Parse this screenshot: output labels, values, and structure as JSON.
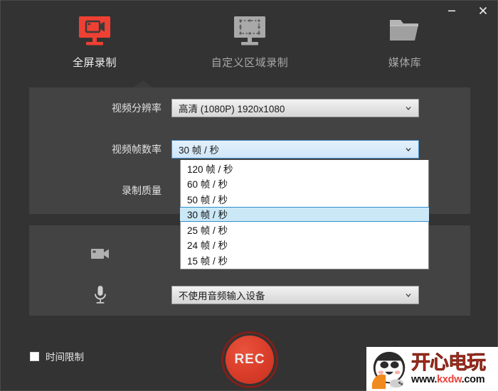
{
  "window": {
    "minimize_label": "—",
    "close_label": "✕",
    "bg_color": "#333333",
    "panel_color": "#434343",
    "accent_color": "#e8403a"
  },
  "tabs": [
    {
      "label": "全屏录制",
      "icon": "monitor-record-icon",
      "active": true
    },
    {
      "label": "自定义区域录制",
      "icon": "monitor-region-icon",
      "active": false
    },
    {
      "label": "媒体库",
      "icon": "folder-icon",
      "active": false
    }
  ],
  "video_panel": {
    "rows": [
      {
        "label": "视频分辨率",
        "value": "高清 (1080P)   1920x1080"
      },
      {
        "label": "视频帧数率",
        "value": "30 帧 / 秒"
      },
      {
        "label": "录制质量",
        "value": ""
      }
    ]
  },
  "fps_dropdown": {
    "open": true,
    "selected": "30 帧 / 秒",
    "options": [
      "120 帧 / 秒",
      "60 帧 / 秒",
      "50 帧 / 秒",
      "30 帧 / 秒",
      "25 帧 / 秒",
      "24 帧 / 秒",
      "15 帧 / 秒"
    ]
  },
  "device_panel": {
    "rows": [
      {
        "icon": "camera-icon",
        "value": ""
      },
      {
        "icon": "microphone-icon",
        "value": "不使用音频输入设备"
      }
    ]
  },
  "bottom": {
    "time_limit_label": "时间限制",
    "time_limit_checked": false,
    "rec_label": "REC"
  },
  "watermark": {
    "brand_cn": "开心电玩",
    "url_prefix": "www.",
    "url_highlight": "kxdw",
    "url_suffix": ".com"
  }
}
